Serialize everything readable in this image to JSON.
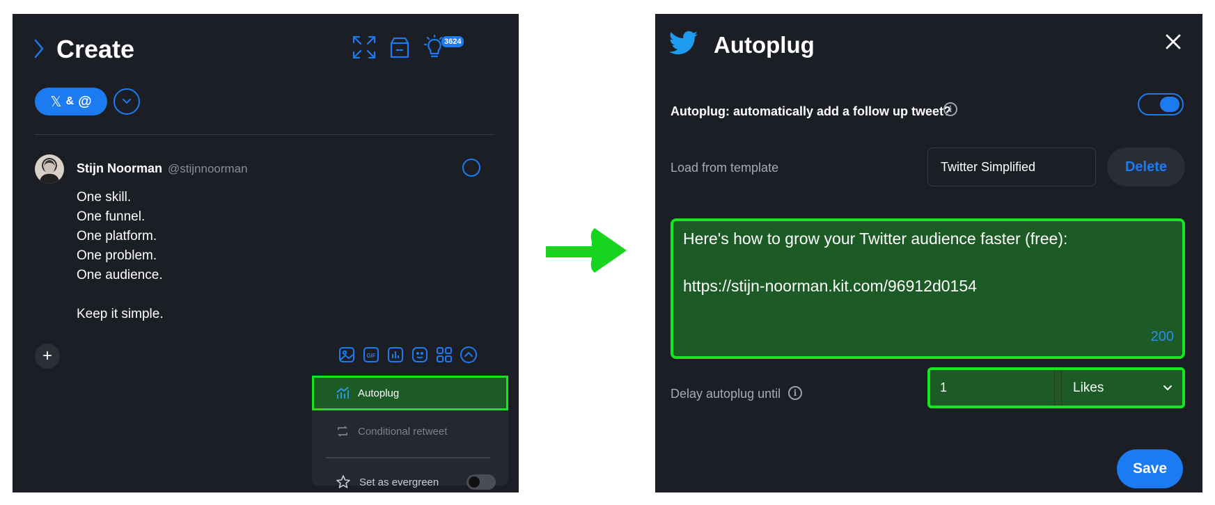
{
  "left": {
    "title": "Create",
    "badge_count": "3624",
    "platform_pill": {
      "x_glyph": "𝕏",
      "amp": "&",
      "threads_glyph": "@"
    },
    "user": {
      "name": "Stijn Noorman",
      "handle": "@stijnnoorman"
    },
    "tweet_lines": [
      "One skill.",
      "One funnel.",
      "One platform.",
      "One problem.",
      "One audience.",
      "Keep it simple."
    ],
    "plus_label": "+",
    "menu": {
      "autoplug": "Autoplug",
      "conditional_retweet": "Conditional retweet",
      "set_as_evergreen": "Set as evergreen"
    }
  },
  "right": {
    "title": "Autoplug",
    "question": "Autoplug: automatically add a follow up tweet?",
    "info_glyph": "i",
    "toggle_on": true,
    "template_label": "Load from template",
    "template_value": "Twitter Simplified",
    "delete_label": "Delete",
    "message_lines": [
      "Here's how to grow your Twitter audience faster (free):",
      "",
      "https://stijn-noorman.kit.com/96912d0154"
    ],
    "char_count": "200",
    "delay_label": "Delay autoplug until",
    "delay_value": "1",
    "delay_unit": "Likes",
    "save_label": "Save"
  },
  "colors": {
    "panel_bg": "#1c1e26",
    "accent": "#1d7bf2",
    "highlight_green": "#17e51f",
    "highlight_fill": "#1c5a26"
  }
}
